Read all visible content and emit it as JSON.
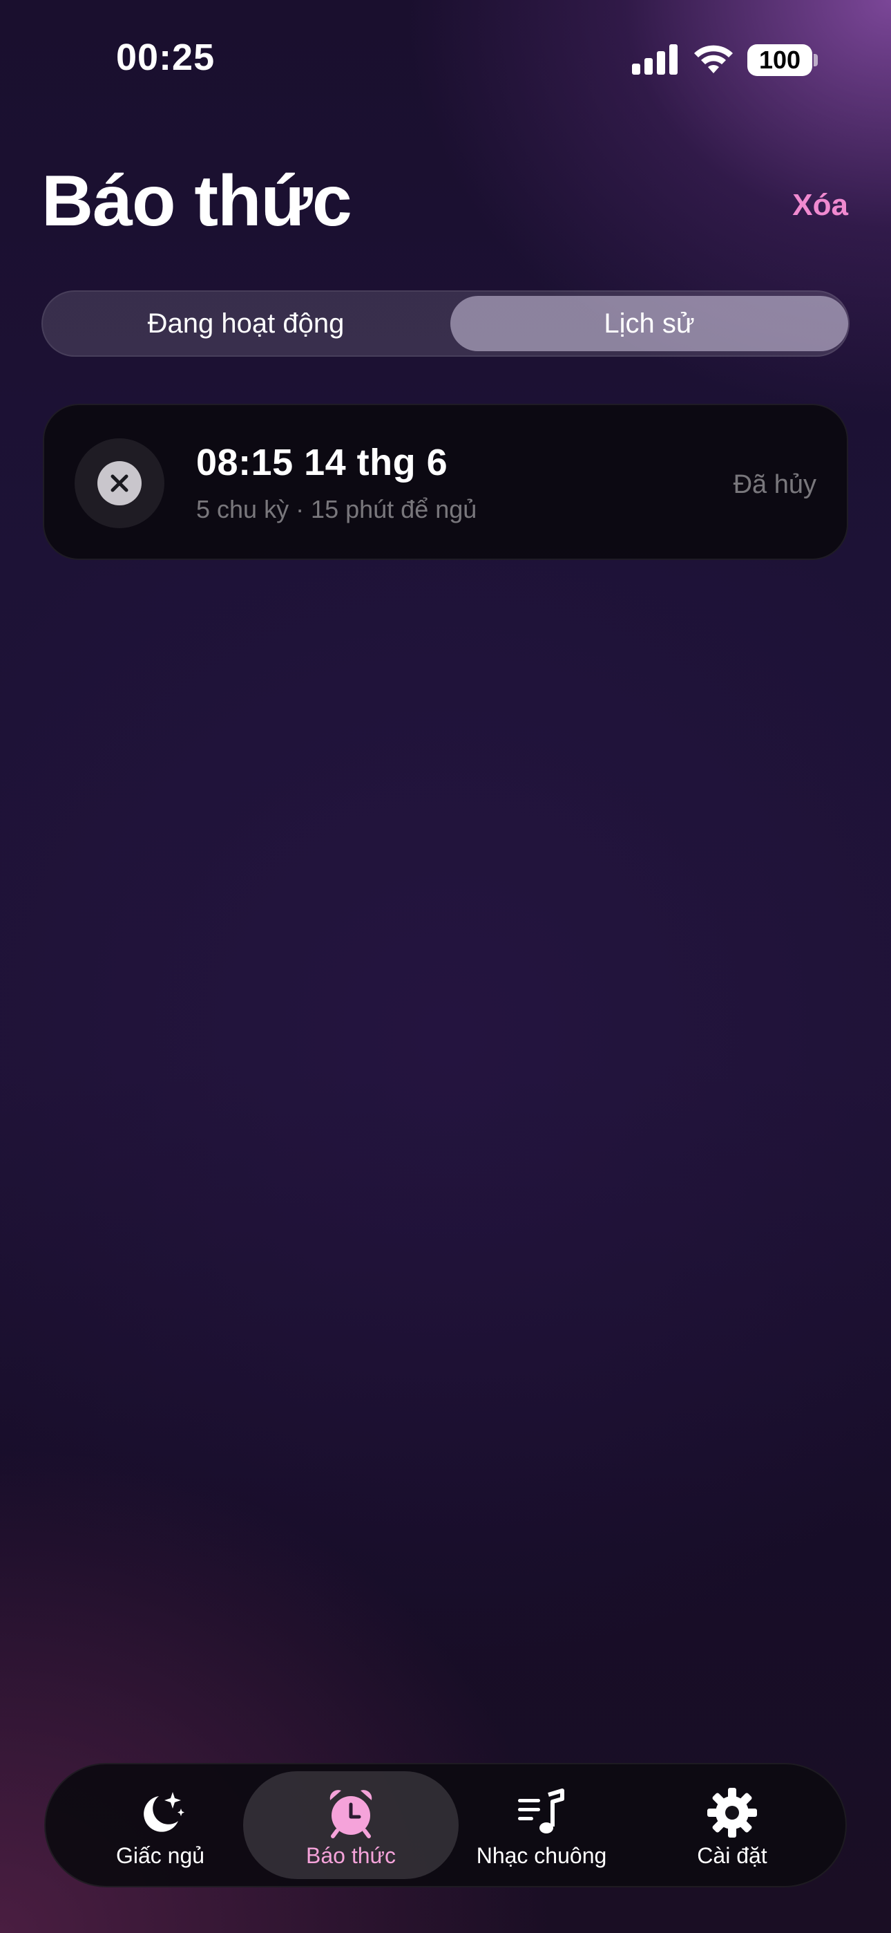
{
  "status_bar": {
    "time": "00:25",
    "battery": "100"
  },
  "header": {
    "title": "Báo thức",
    "clear_label": "Xóa"
  },
  "segments": {
    "active_label": "Đang hoạt động",
    "history_label": "Lịch sử",
    "selected": "Lịch sử"
  },
  "history": [
    {
      "time": "08:15 14 thg 6",
      "subtitle": "5 chu kỳ · 15 phút để ngủ",
      "status": "Đã hủy",
      "icon": "x-circle-icon"
    }
  ],
  "tabs": [
    {
      "label": "Giấc ngủ",
      "icon": "moon-stars-icon",
      "active": false
    },
    {
      "label": "Báo thức",
      "icon": "alarm-clock-icon",
      "active": true
    },
    {
      "label": "Nhạc chuông",
      "icon": "music-list-icon",
      "active": false
    },
    {
      "label": "Cài đặt",
      "icon": "gear-icon",
      "active": false
    }
  ],
  "colors": {
    "accent": "#f08ad0",
    "active_tab": "#f5a3da"
  }
}
